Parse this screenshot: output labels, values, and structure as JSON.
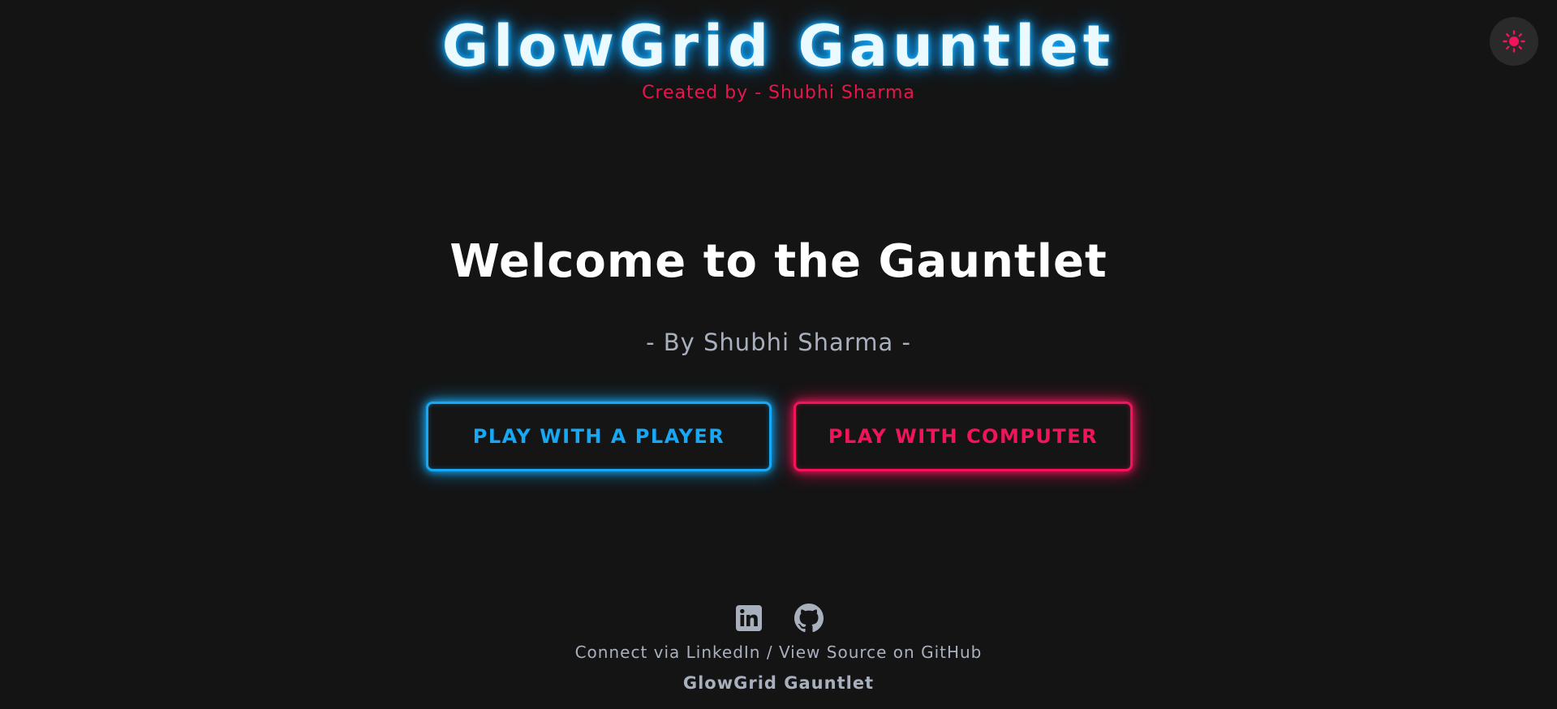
{
  "header": {
    "title": "GlowGrid Gauntlet",
    "subtitle": "Created by - Shubhi Sharma"
  },
  "theme_toggle": {
    "icon": "sun-icon",
    "color": "#f2145a"
  },
  "main": {
    "heading": "Welcome to the Gauntlet",
    "byline": "- By Shubhi Sharma -",
    "buttons": {
      "player": "PLAY WITH A PLAYER",
      "computer": "PLAY WITH COMPUTER"
    }
  },
  "footer": {
    "icons": [
      "linkedin-icon",
      "github-icon"
    ],
    "linkedin_text": "Connect via LinkedIn",
    "separator": " / ",
    "github_text": "View Source on GitHub",
    "brand": "GlowGrid Gauntlet"
  },
  "colors": {
    "background": "#141414",
    "accent_blue": "#16a8f5",
    "accent_pink": "#f2145a",
    "muted_text": "#a9b0bd"
  }
}
